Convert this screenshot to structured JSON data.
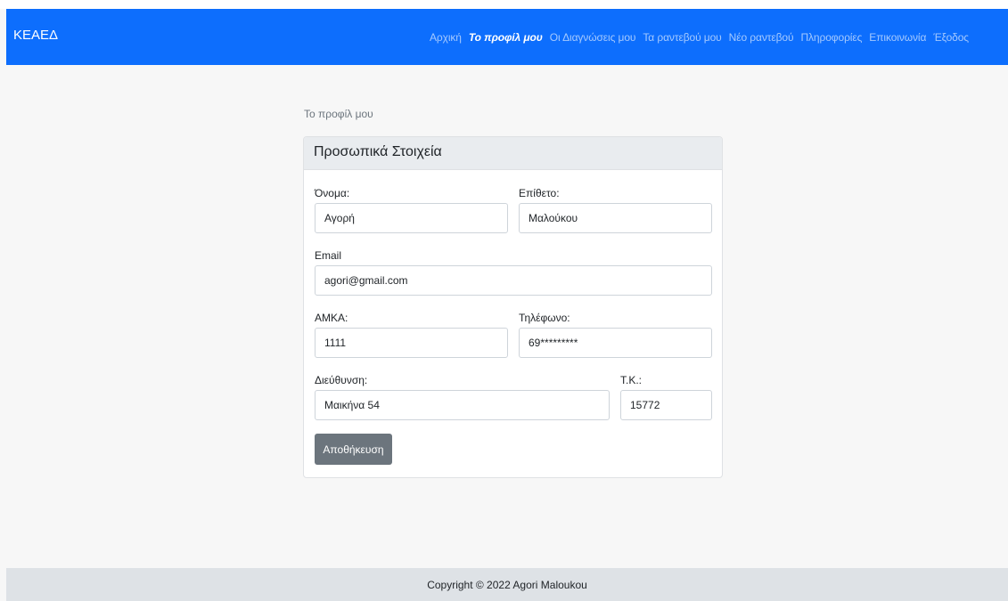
{
  "navbar": {
    "brand": "ΚΕΑΕΔ",
    "links": [
      {
        "label": "Αρχική",
        "active": false
      },
      {
        "label": "Το προφίλ μου",
        "active": true
      },
      {
        "label": "Οι Διαγνώσεις μου",
        "active": false
      },
      {
        "label": "Τα ραντεβού μου",
        "active": false
      },
      {
        "label": "Νέο ραντεβού",
        "active": false
      },
      {
        "label": "Πληροφορίες",
        "active": false
      },
      {
        "label": "Επικοινωνία",
        "active": false
      },
      {
        "label": "Έξοδος",
        "active": false
      }
    ],
    "color": "#0d6efd"
  },
  "breadcrumb": "Το προφίλ μου",
  "card": {
    "title": "Προσωπικά Στοιχεία",
    "fields": {
      "first_name": {
        "label": "Όνομα:",
        "value": "Αγορή"
      },
      "last_name": {
        "label": "Επίθετο:",
        "value": "Μαλούκου"
      },
      "email": {
        "label": "Email",
        "value": "agori@gmail.com"
      },
      "amka": {
        "label": "ΑΜΚΑ:",
        "value": "1111"
      },
      "phone": {
        "label": "Τηλέφωνο:",
        "value": "69*********"
      },
      "address": {
        "label": "Διεύθυνση:",
        "value": "Μαικήνα 54"
      },
      "postal_code": {
        "label": "Τ.Κ.:",
        "value": "15772"
      }
    },
    "save_label": "Αποθήκευση"
  },
  "footer": {
    "text": "Copyright © 2022 Agori Maloukou"
  }
}
